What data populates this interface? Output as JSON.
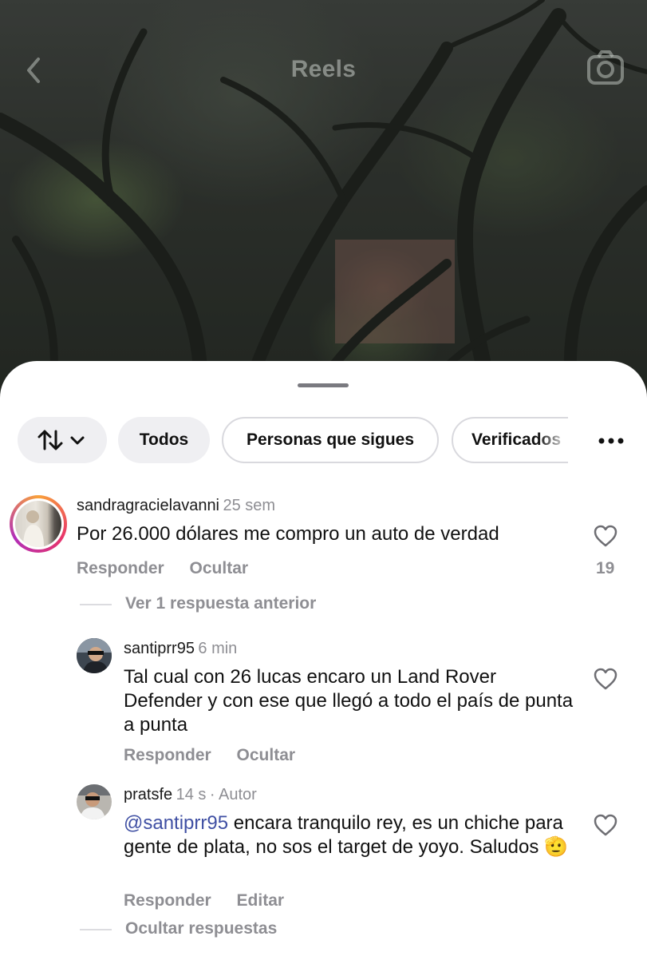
{
  "header": {
    "title": "Reels",
    "back_icon": "chevron-left-icon",
    "camera_icon": "camera-icon"
  },
  "filters": {
    "sort_icon": "sort-arrows-icon",
    "chips": [
      "Todos",
      "Personas que sigues",
      "Verificados"
    ],
    "more_icon": "more-horizontal-icon"
  },
  "comments": [
    {
      "username": "sandragracielavanni",
      "time": "25 sem",
      "text": "Por 26.000 dólares me compro un auto de verdad",
      "reply_label": "Responder",
      "second_action": "Ocultar",
      "likes": "19",
      "view_replies": "Ver 1 respuesta anterior"
    },
    {
      "username": "santiprr95",
      "time": "6 min",
      "text": "Tal cual con 26 lucas encaro un Land Rover Defender y con ese que llegó a todo el país de punta a punta",
      "reply_label": "Responder",
      "second_action": "Ocultar"
    },
    {
      "username": "pratsfe",
      "time": "14 s",
      "author_badge": "· Autor",
      "mention": "@santiprr95",
      "text": " encara tranquilo rey, es un chiche para gente de plata, no sos el target de yoyo. Saludos ",
      "emoji": "🫡",
      "reply_label": "Responder",
      "second_action": "Editar",
      "hide_replies": "Ocultar respuestas"
    }
  ],
  "colors": {
    "accent_mention": "#3f4fa3",
    "muted": "#8e8e93",
    "story_ring": [
      "#f9a13a",
      "#e8346a",
      "#b12fb8"
    ]
  }
}
